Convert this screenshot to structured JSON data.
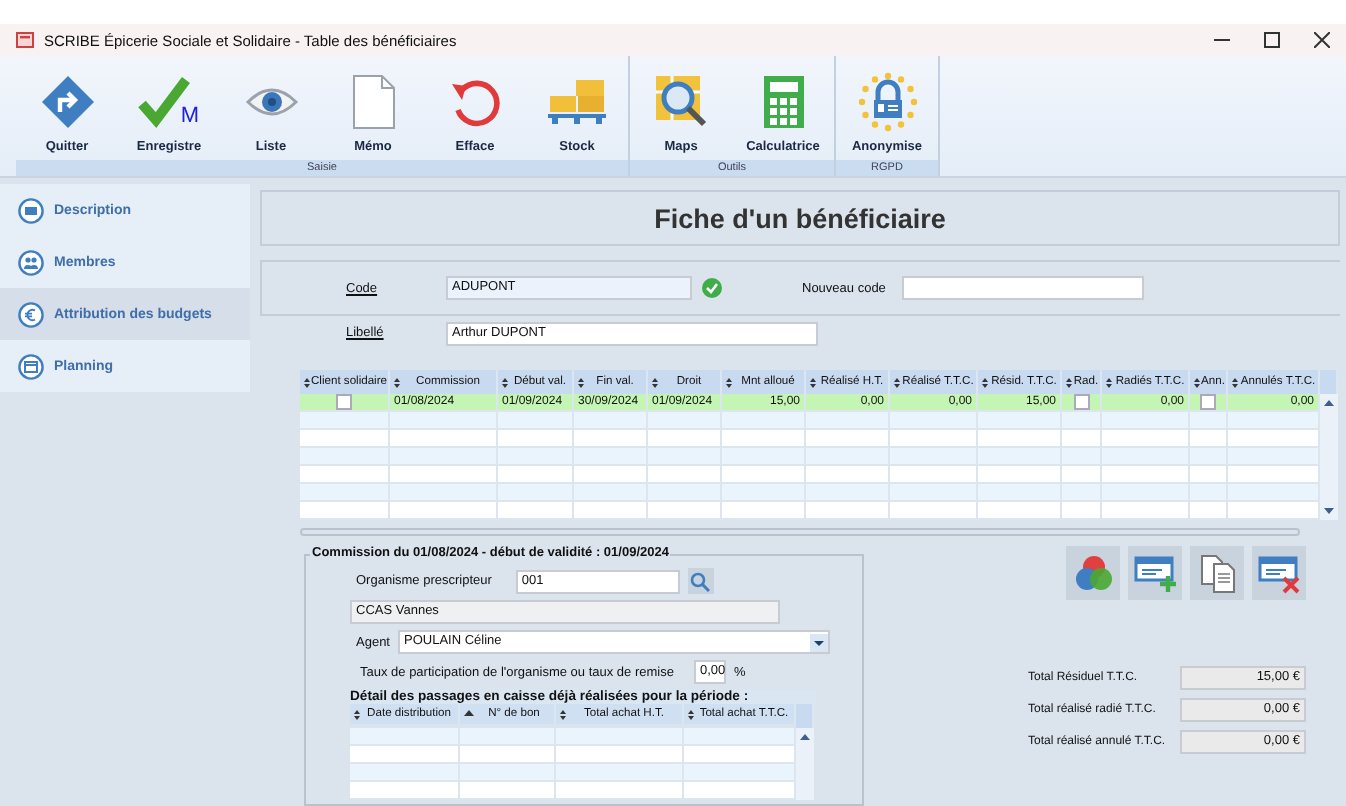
{
  "window": {
    "title": "SCRIBE Épicerie Sociale et Solidaire - Table des bénéficiaires"
  },
  "ribbon": {
    "groups": [
      {
        "label": "Saisie",
        "buttons": [
          {
            "kind": "exit",
            "label": "Quitter"
          },
          {
            "kind": "save",
            "label": "Enregistre",
            "badge": "M"
          },
          {
            "kind": "view",
            "label": "Liste"
          },
          {
            "kind": "memo",
            "label": "Mémo"
          },
          {
            "kind": "undo",
            "label": "Efface"
          },
          {
            "kind": "stock",
            "label": "Stock"
          }
        ]
      },
      {
        "label": "Outils",
        "buttons": [
          {
            "kind": "map",
            "label": "Maps"
          },
          {
            "kind": "calc",
            "label": "Calculatrice"
          }
        ]
      },
      {
        "label": "RGPD",
        "buttons": [
          {
            "kind": "lock",
            "label": "Anonymise"
          }
        ]
      }
    ]
  },
  "sidebar": {
    "items": [
      {
        "kind": "folder",
        "label": "Description",
        "selected": false
      },
      {
        "kind": "people",
        "label": "Membres",
        "selected": false
      },
      {
        "kind": "euro",
        "label": "Attribution des budgets",
        "selected": true
      },
      {
        "kind": "calendar",
        "label": "Planning",
        "selected": false
      }
    ]
  },
  "form": {
    "title": "Fiche d'un bénéficiaire",
    "code_label": "Code",
    "code_value": "ADUPONT",
    "new_code_label": "Nouveau code",
    "libelle_label": "Libellé",
    "libelle_value": "Arthur DUPONT"
  },
  "table": {
    "columns": [
      "Client solidaire",
      "Commission",
      "Début val.",
      "Fin val.",
      "Droit",
      "Mnt alloué",
      "Réalisé H.T.",
      "Réalisé T.T.C.",
      "Résid. T.T.C.",
      "Rad.",
      "Radiés T.T.C.",
      "Ann.",
      "Annulés T.T.C."
    ],
    "rows": [
      {
        "selected": true,
        "cells": [
          {
            "checked": false
          },
          {
            "text": "01/08/2024"
          },
          {
            "text": "01/09/2024"
          },
          {
            "text": "30/09/2024"
          },
          {
            "text": "01/09/2024"
          },
          {
            "text": "15,00"
          },
          {
            "text": "0,00"
          },
          {
            "text": "0,00"
          },
          {
            "text": "15,00"
          },
          {
            "checked": false
          },
          {
            "text": "0,00"
          },
          {
            "checked": false
          },
          {
            "text": "0,00"
          }
        ]
      }
    ]
  },
  "commission": {
    "legend": "Commission du 01/08/2024 - début de validité : 01/09/2024",
    "organisme_label": "Organisme prescripteur",
    "organisme_value": "001",
    "organisme_name": "CCAS Vannes",
    "agent_label": "Agent",
    "agent_value": "POULAIN Céline",
    "taux_label": "Taux de participation de l'organisme ou taux de remise",
    "taux_value": "0,00",
    "taux_unit": "%",
    "detail": {
      "title": "Détail des passages en caisse déjà réalisées pour la période :",
      "columns": [
        {
          "label": "Date distribution",
          "sorted": false
        },
        {
          "label": "N° de bon",
          "sorted": true
        },
        {
          "label": "Total achat H.T.",
          "sorted": false
        },
        {
          "label": "Total achat T.T.C.",
          "sorted": false
        }
      ]
    }
  },
  "actions": [
    {
      "kind": "colors"
    },
    {
      "kind": "add"
    },
    {
      "kind": "copy"
    },
    {
      "kind": "delete"
    }
  ],
  "totals": [
    {
      "label": "Total Résiduel T.T.C.",
      "value": "15,00 €"
    },
    {
      "label": "Total réalisé radié T.T.C.",
      "value": "0,00 €"
    },
    {
      "label": "Total réalisé annulé T.T.C.",
      "value": "0,00 €"
    }
  ]
}
